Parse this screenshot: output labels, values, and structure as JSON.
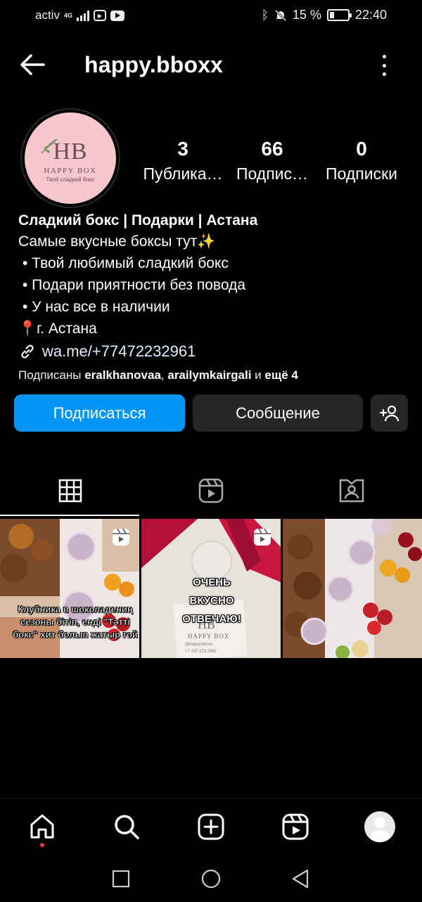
{
  "status_bar": {
    "carrier": "activ",
    "network": "4G",
    "battery": "15 %",
    "time": "22:40"
  },
  "header": {
    "username": "happy.bboxx"
  },
  "avatar": {
    "logo_text": "HB",
    "logo_name": "HAPPY BOX",
    "logo_sub": "Твой сладкий бокс"
  },
  "stats": [
    {
      "value": "3",
      "label": "Публика…"
    },
    {
      "value": "66",
      "label": "Подпис…"
    },
    {
      "value": "0",
      "label": "Подписки"
    }
  ],
  "bio": {
    "name": "Сладкий бокс | Подарки | Астана",
    "line1": "Самые вкусные боксы тут✨",
    "bullets": [
      "•  Твой любимый сладкий бокс",
      "•  Подари приятности без повода",
      "•  У нас все в наличии"
    ],
    "location": "📍г. Астана",
    "link": "wa.me/+77472232961",
    "followed_prefix": "Подписаны ",
    "followed_user1": "eralkhanovaa",
    "followed_sep": ", ",
    "followed_user2": "arailymkairgali",
    "followed_and": " и ",
    "followed_more": "ещё 4"
  },
  "actions": {
    "follow": "Подписаться",
    "message": "Сообщение"
  },
  "posts": [
    {
      "caption": "Клубника в шоколадениң сезоны бітіп, енді \"Тәтті бокс\" хит болып жатыр гой"
    },
    {
      "caption": "ОЧЕНЬ ВКУСНО ОТВЕЧАЮ!",
      "card_logo": "HB",
      "card_name": "HAPPY BOX",
      "card_handle": "@happy.bboxx",
      "card_phone": "+7 747 223 2961"
    },
    {
      "caption": ""
    }
  ],
  "colors": {
    "background": "#000000",
    "follow_button": "#0095f6",
    "secondary_button": "#262626",
    "avatar_bg": "#f7c7cf",
    "notification_dot": "#ff3040"
  },
  "icons": [
    "back-arrow-icon",
    "more-vertical-icon",
    "grid-icon",
    "reels-icon",
    "tagged-icon",
    "add-person-icon",
    "home-icon",
    "search-icon",
    "create-icon",
    "reels-nav-icon",
    "profile-icon",
    "recent-apps-icon",
    "home-circle-icon",
    "back-triangle-icon"
  ]
}
